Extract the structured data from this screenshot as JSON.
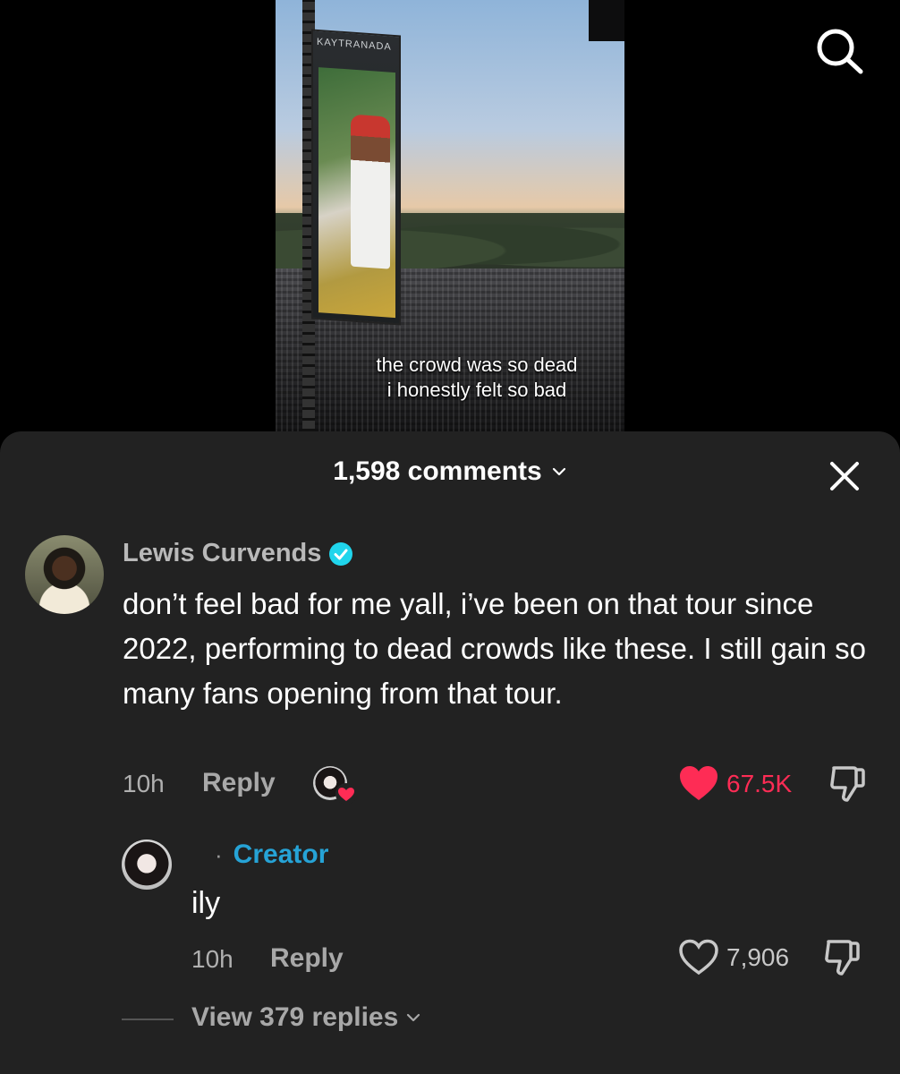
{
  "video": {
    "caption_line1": "the crowd was so dead",
    "caption_line2": "i honestly felt so bad",
    "screen_brand": "KAYTRANADA"
  },
  "comments_sheet": {
    "count_label": "1,598 comments"
  },
  "comment": {
    "username": "Lewis Curvends",
    "text": "don’t feel bad for me yall, i’ve been on that tour since 2022, performing to dead crowds like these. I still gain so many fans opening from that tour.",
    "time": "10h",
    "reply_label": "Reply",
    "like_count": "67.5K",
    "liked": true,
    "like_color": "#fe2c55"
  },
  "reply": {
    "dot": "·",
    "creator_label": "Creator",
    "text": "ily",
    "time": "10h",
    "reply_label": "Reply",
    "like_count": "7,906",
    "creator_color": "#26a3d6"
  },
  "view_replies_label": "View 379 replies"
}
